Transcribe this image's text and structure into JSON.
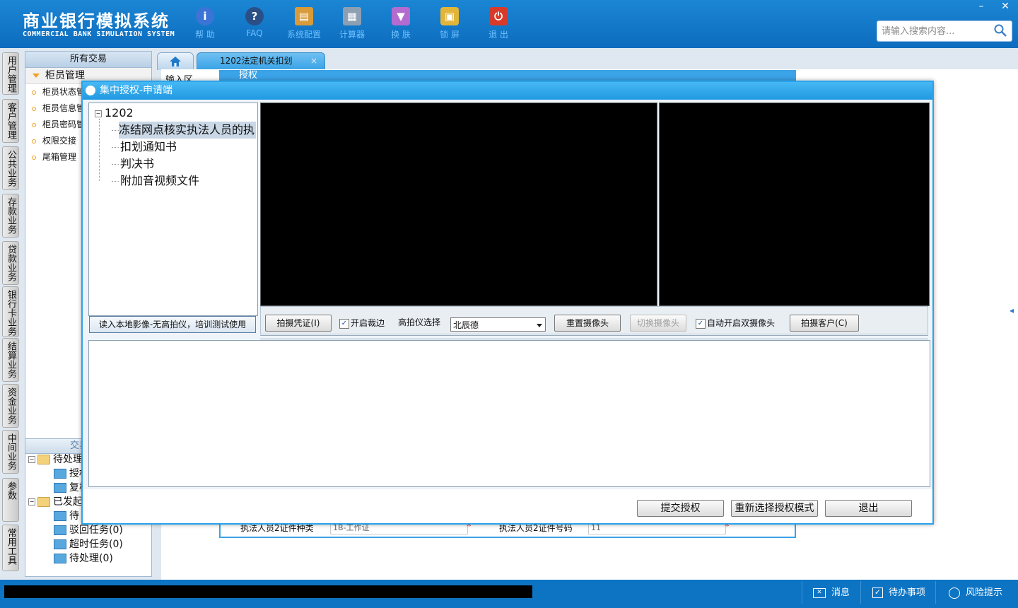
{
  "header": {
    "title": "商业银行模拟系统",
    "subtitle": "COMMERCIAL BANK SIMULATION SYSTEM",
    "toolbar": [
      {
        "label": "帮 助",
        "icon": "info-icon"
      },
      {
        "label": "FAQ",
        "icon": "question-icon"
      },
      {
        "label": "系统配置",
        "icon": "toolbox-icon"
      },
      {
        "label": "计算器",
        "icon": "calculator-icon"
      },
      {
        "label": "换 肤",
        "icon": "shirt-icon"
      },
      {
        "label": "锁 屏",
        "icon": "lock-icon"
      },
      {
        "label": "退 出",
        "icon": "power-icon"
      }
    ],
    "search_placeholder": "请输入搜索内容..."
  },
  "side_nav": [
    "用户管理",
    "客户管理",
    "公共业务",
    "存款业务",
    "贷款业务",
    "银行卡业务",
    "结算业务",
    "资金业务",
    "中间业务",
    "参数",
    "常用工具"
  ],
  "left_panel": {
    "header": "所有交易",
    "group": "柜员管理",
    "items": [
      "柜员状态管",
      "柜员信息管",
      "柜员密码管",
      "权限交接",
      "尾箱管理"
    ],
    "trans_info_header": "交易信息",
    "tree": [
      {
        "label": "待处理"
      },
      {
        "label": "授权"
      },
      {
        "label": "复核"
      },
      {
        "label": "已发起"
      },
      {
        "label": "待"
      },
      {
        "label": "驳回任务(0)"
      },
      {
        "label": "超时任务(0)"
      },
      {
        "label": "待处理(0)"
      }
    ]
  },
  "tabs": {
    "active": "1202法定机关扣划",
    "close": "×"
  },
  "background_form": {
    "title": "授权",
    "input_area_label": "输入区",
    "row_label1": "执法人员2证件种类",
    "row_value1": "1B-工作证",
    "row_label2": "执法人员2证件号码",
    "row_value2": "11",
    "required": "*"
  },
  "dialog": {
    "title": "集中授权-申请端",
    "tree_root": "1202",
    "tree_items": [
      "冻结网点核实执法人员的执",
      "扣划通知书",
      "判决书",
      "附加音视频文件"
    ],
    "read_local_button": "读入本地影像-无高拍仪，培训测试使用",
    "capture_voucher_button": "拍摄凭证(I)",
    "auto_crop_label": "开启裁边",
    "auto_crop_checked": true,
    "scanner_label": "高拍仪选择",
    "scanner_value": "北辰德",
    "reset_camera_button": "重置摄像头",
    "switch_camera_button": "切换摄像头",
    "dual_camera_label": "自动开启双摄像头",
    "dual_camera_checked": true,
    "capture_customer_button": "拍摄客户(C)",
    "submit_button": "提交授权",
    "reselect_button": "重新选择授权模式",
    "exit_button": "退出"
  },
  "status_bar": {
    "messages": "消息",
    "todo": "待办事项",
    "risk": "风险提示"
  }
}
